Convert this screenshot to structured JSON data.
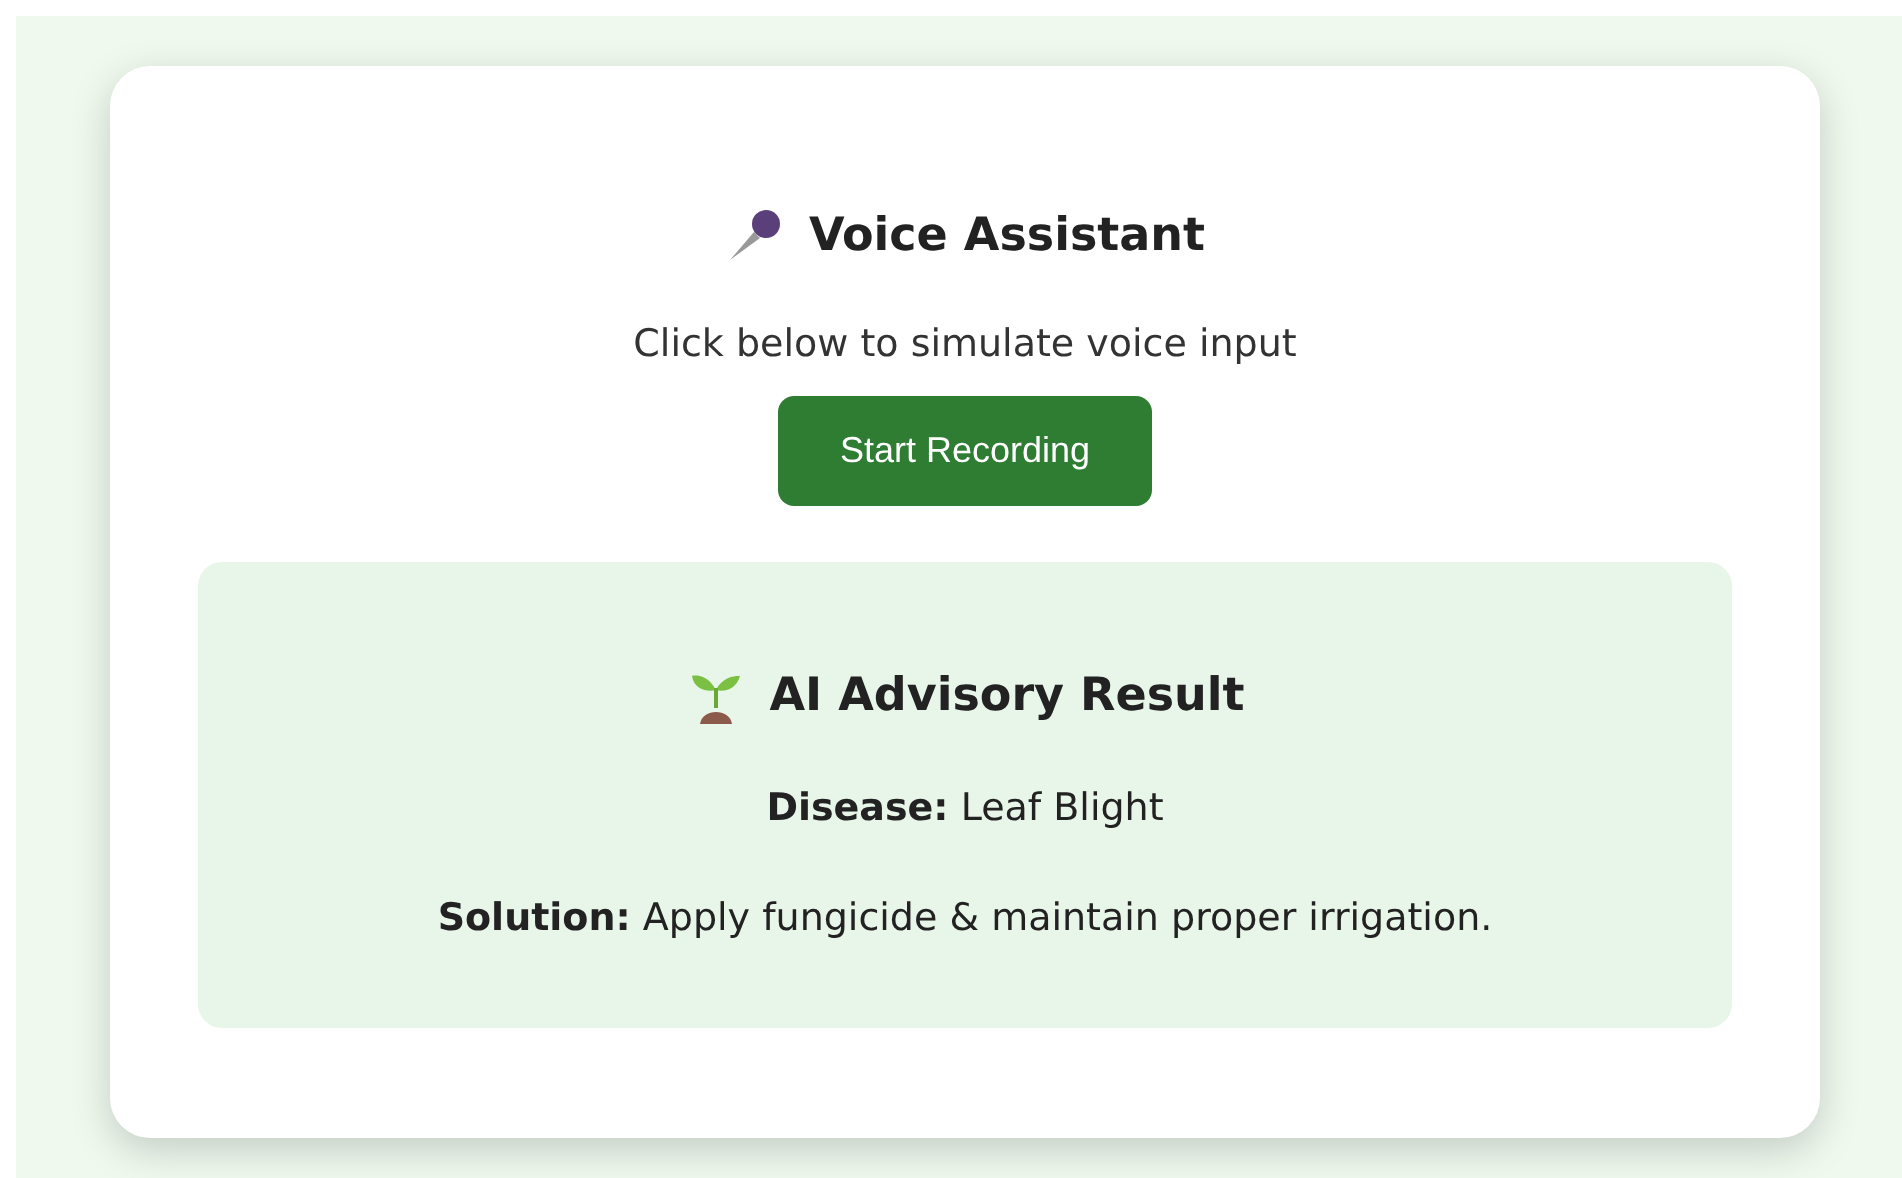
{
  "voice_assistant": {
    "title": "Voice Assistant",
    "instruction": "Click below to simulate voice input",
    "button": "Start Recording"
  },
  "result": {
    "title": "AI Advisory Result",
    "lines": [
      "**Disease:** Leaf Blight",
      "**Solution:** Apply fungicide & maintain proper irrigation."
    ]
  }
}
